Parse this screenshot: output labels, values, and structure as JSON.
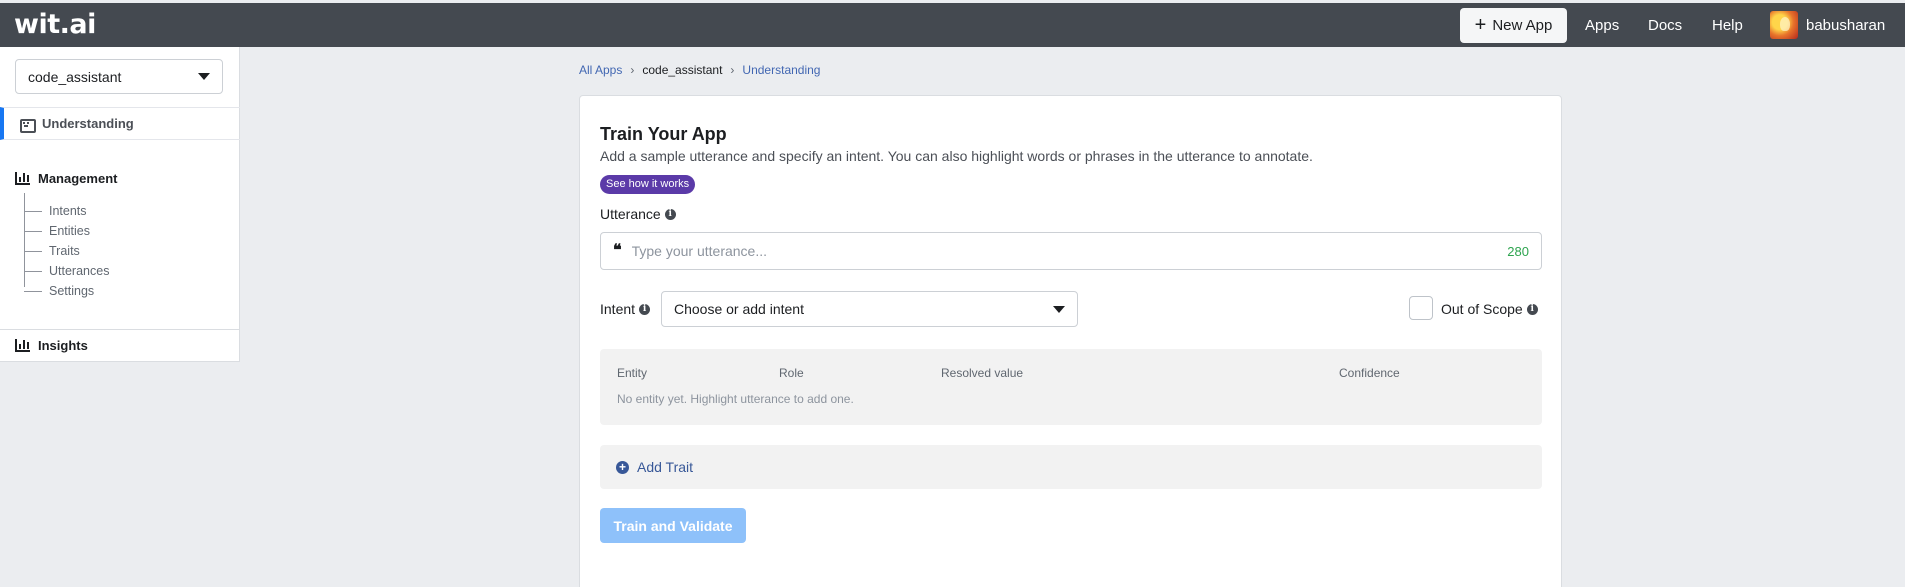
{
  "header": {
    "logo": "wit.ai",
    "new_app": "New App",
    "nav": [
      "Apps",
      "Docs",
      "Help"
    ],
    "username": "babusharan"
  },
  "sidebar": {
    "app_selected": "code_assistant",
    "understanding": "Understanding",
    "management": "Management",
    "management_items": [
      "Intents",
      "Entities",
      "Traits",
      "Utterances",
      "Settings"
    ],
    "insights": "Insights"
  },
  "breadcrumb": {
    "all_apps": "All Apps",
    "app": "code_assistant",
    "current": "Understanding"
  },
  "train": {
    "title": "Train Your App",
    "subtitle": "Add a sample utterance and specify an intent. You can also highlight words or phrases in the utterance to annotate.",
    "see_how": "See how it works",
    "utterance_label": "Utterance",
    "utterance_placeholder": "Type your utterance...",
    "utterance_value": "",
    "char_count": "280",
    "intent_label": "Intent",
    "intent_placeholder": "Choose or add intent",
    "out_of_scope": "Out of Scope",
    "entity_table": {
      "headers": [
        "Entity",
        "Role",
        "Resolved value",
        "Confidence"
      ],
      "empty_text": "No entity yet. Highlight utterance to add one."
    },
    "add_trait": "Add Trait",
    "train_button": "Train and Validate"
  }
}
